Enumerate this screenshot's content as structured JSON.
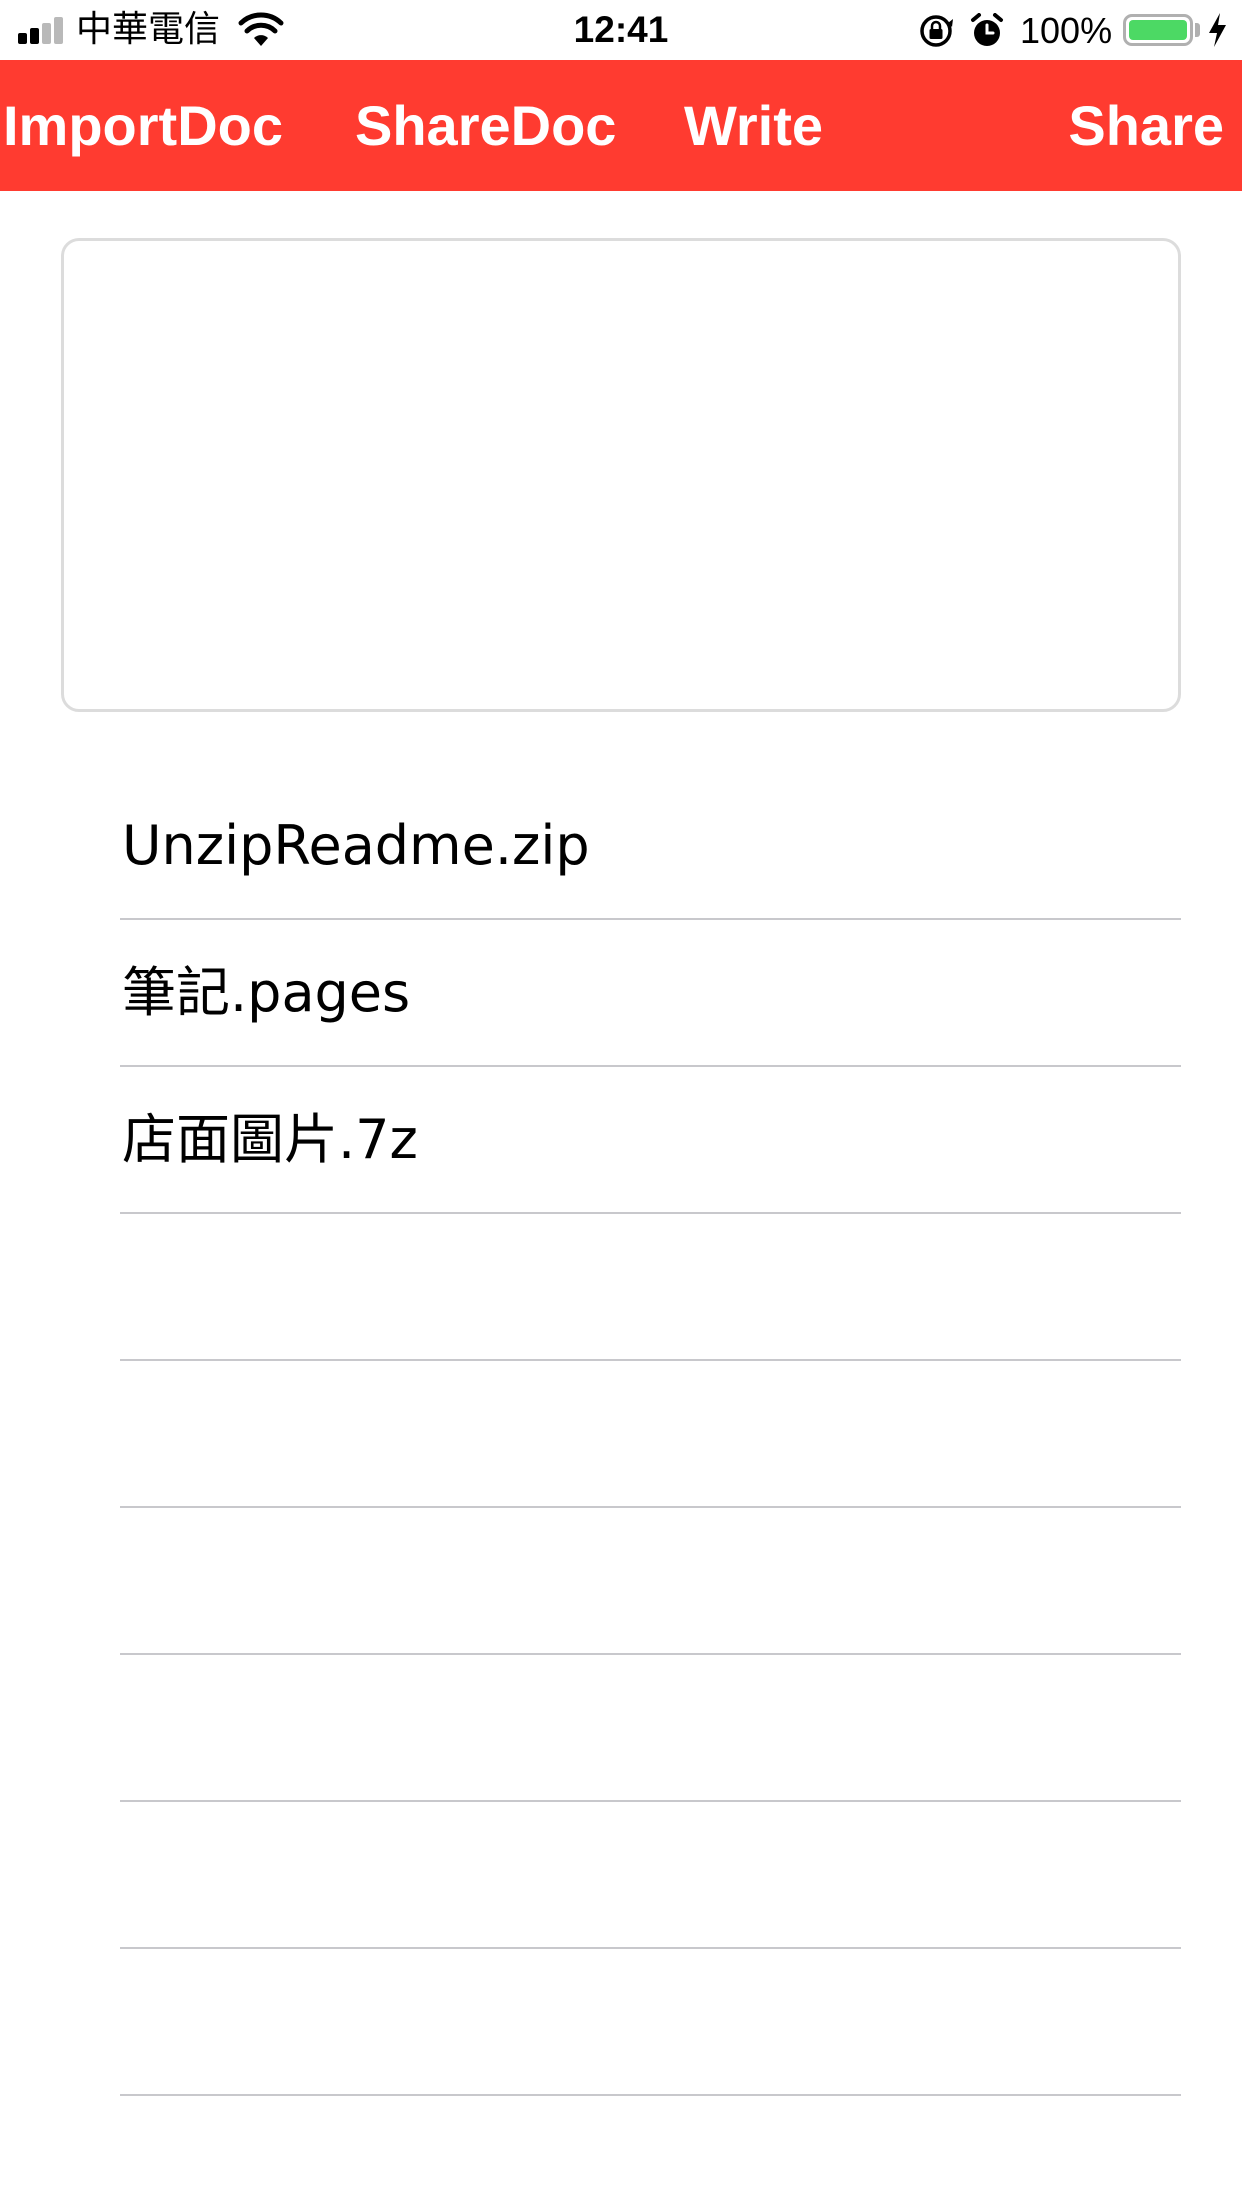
{
  "status_bar": {
    "carrier": "中華電信",
    "time": "12:41",
    "battery_percent": "100%",
    "battery_level": 1.0,
    "signal_bars": 2,
    "signal_bars_total": 4,
    "icons": [
      "signal-icon",
      "wifi-icon",
      "rotation-lock-icon",
      "alarm-icon",
      "battery-icon",
      "charging-icon"
    ]
  },
  "toolbar": {
    "color": "#ff3b30",
    "import_doc": "ImportDoc",
    "share_doc": "ShareDoc",
    "write": "Write",
    "share": "Share"
  },
  "editor": {
    "text": ""
  },
  "file_list": {
    "items": [
      {
        "name": "UnzipReadme.zip"
      },
      {
        "name": "筆記.pages"
      },
      {
        "name": "店面圖片.7z"
      },
      {
        "name": ""
      },
      {
        "name": ""
      },
      {
        "name": ""
      },
      {
        "name": ""
      },
      {
        "name": ""
      },
      {
        "name": ""
      }
    ]
  },
  "colors": {
    "accent": "#ff3b30",
    "battery": "#4cd964",
    "separator": "#c8c8cc"
  }
}
